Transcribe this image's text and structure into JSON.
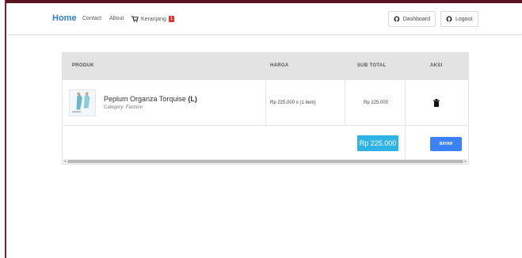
{
  "navbar": {
    "brand": "Home",
    "contact": "Contact",
    "about": "About",
    "cart_label": "Keranjang",
    "cart_count": "1",
    "dashboard": "Dashboard",
    "logout": "Logout"
  },
  "table": {
    "headers": {
      "produk": "PRODUK",
      "harga": "HARGA",
      "subtotal": "SUB TOTAL",
      "aksi": "AKSI"
    },
    "rows": [
      {
        "name": "Peplum Organza Torquise",
        "size": "(L)",
        "category": "Category: Fashion",
        "price": "Rp 225.000 x (1 item)",
        "subtotal": "Rp 225.000",
        "action_icon": "trash-icon"
      }
    ],
    "total": "Rp 225.000",
    "pay_button": "BAYAR"
  },
  "colors": {
    "brand": "#2d7fd4",
    "badge": "#e3342f",
    "total_bg": "#2fb3e6",
    "pay_btn": "#3b82f6"
  }
}
